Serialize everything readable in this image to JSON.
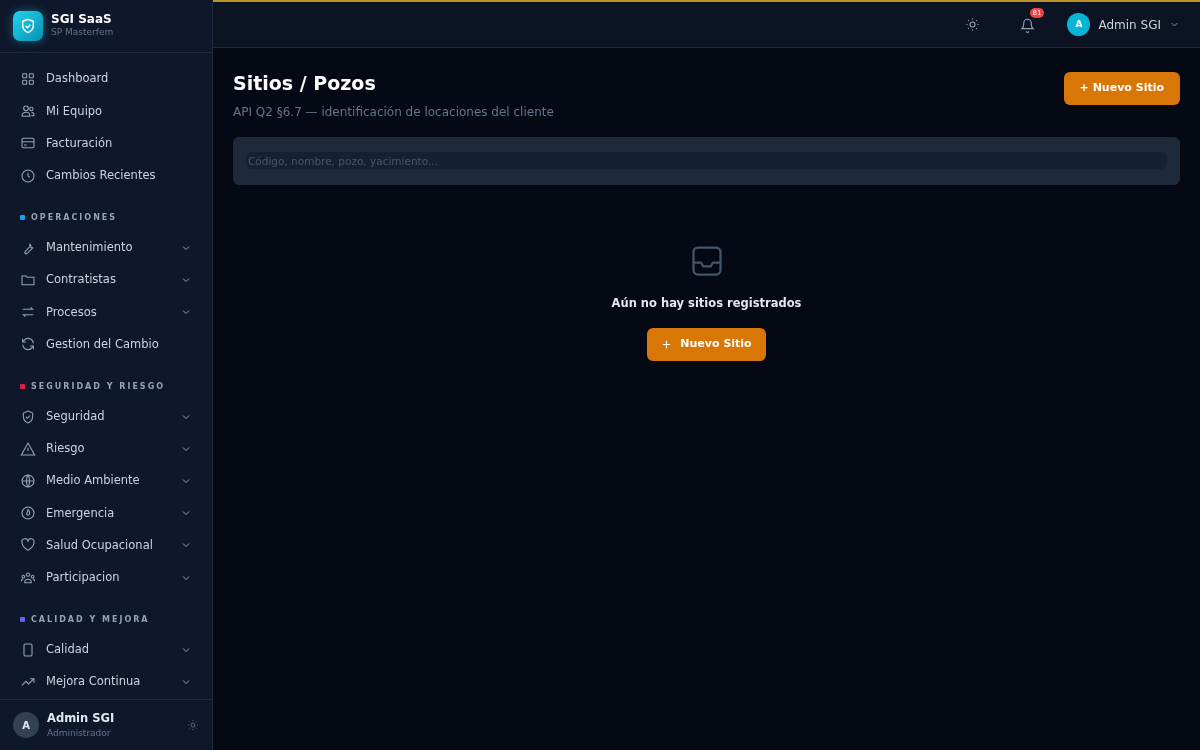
{
  "brand": {
    "title": "SGI SaaS",
    "subtitle": "SP Masterfem"
  },
  "sidebar": {
    "items": [
      {
        "label": "Dashboard",
        "expandable": false
      },
      {
        "label": "Mi Equipo",
        "expandable": false
      },
      {
        "label": "Facturación",
        "expandable": false
      },
      {
        "label": "Cambios Recientes",
        "expandable": false
      }
    ],
    "sections": [
      {
        "title": "OPERACIONES",
        "color": "#0ea5e9",
        "items": [
          {
            "label": "Mantenimiento",
            "expandable": true
          },
          {
            "label": "Contratistas",
            "expandable": true
          },
          {
            "label": "Procesos",
            "expandable": true
          },
          {
            "label": "Gestion del Cambio",
            "expandable": false
          }
        ]
      },
      {
        "title": "SEGURIDAD Y RIESGO",
        "color": "#e11d48",
        "items": [
          {
            "label": "Seguridad",
            "expandable": true
          },
          {
            "label": "Riesgo",
            "expandable": true
          },
          {
            "label": "Medio Ambiente",
            "expandable": true
          },
          {
            "label": "Emergencia",
            "expandable": true
          },
          {
            "label": "Salud Ocupacional",
            "expandable": true
          },
          {
            "label": "Participacion",
            "expandable": true
          }
        ]
      },
      {
        "title": "CALIDAD Y MEJORA",
        "color": "#6366f1",
        "items": [
          {
            "label": "Calidad",
            "expandable": true
          },
          {
            "label": "Mejora Continua",
            "expandable": true
          }
        ]
      }
    ]
  },
  "sidebar_user": {
    "initial": "A",
    "name": "Admin SGI",
    "role": "Administrador"
  },
  "topbar": {
    "notification_count": "81",
    "user_initial": "A",
    "user_name": "Admin SGI"
  },
  "page": {
    "title": "Sitios / Pozos",
    "subtitle": "API Q2 §6.7 — identificación de locaciones del cliente",
    "new_button": "+ Nuevo Sitio"
  },
  "search": {
    "placeholder": "Código, nombre, pozo, yacimiento..."
  },
  "empty_state": {
    "message": "Aún no hay sitios registrados",
    "button": "Nuevo Sitio"
  }
}
